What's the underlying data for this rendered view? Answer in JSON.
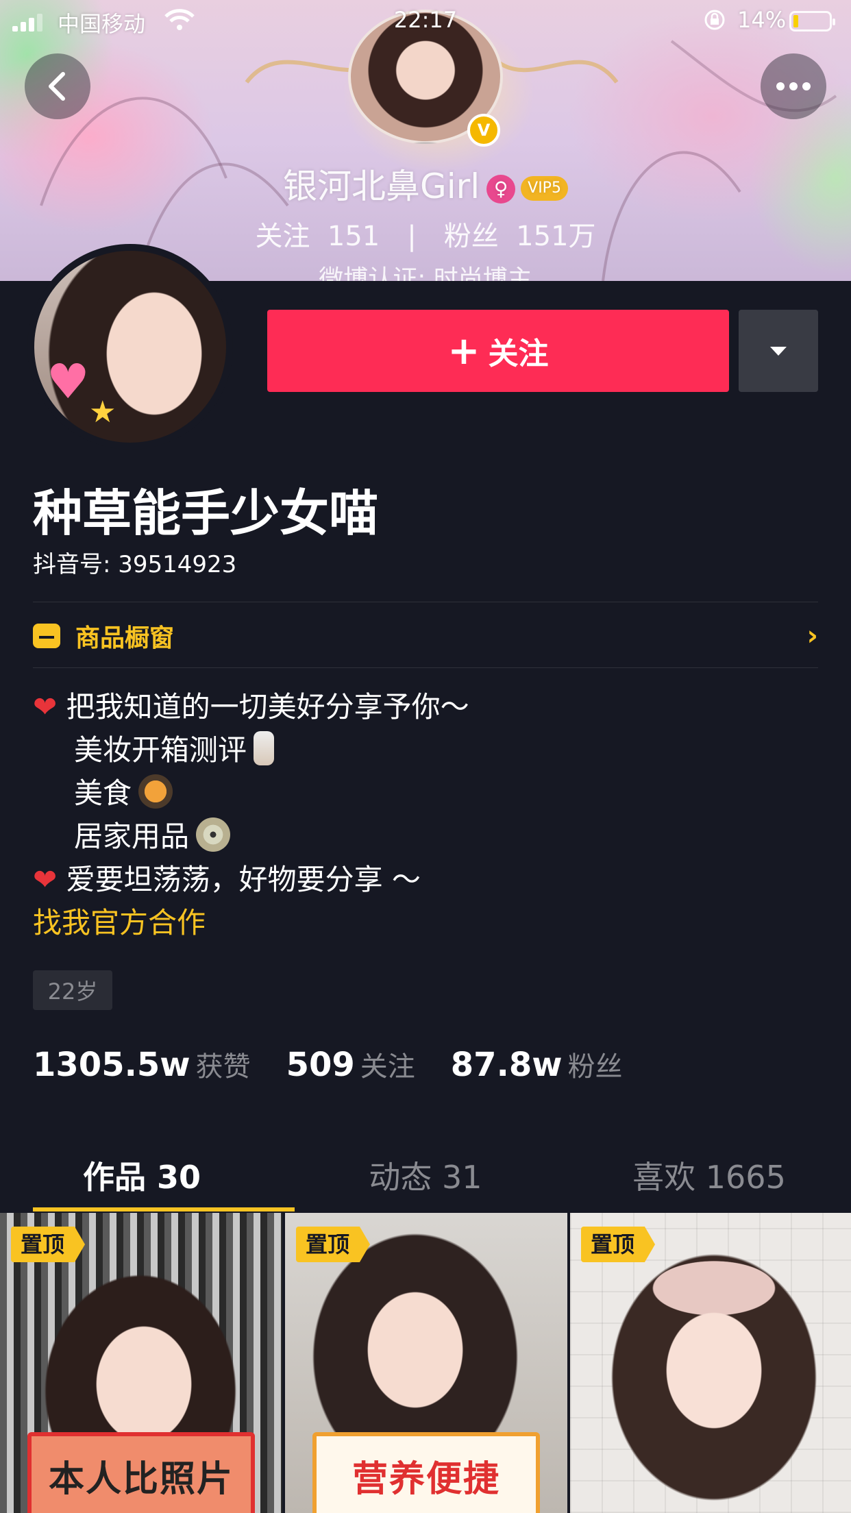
{
  "status_bar": {
    "carrier": "中国移动",
    "time": "22:17",
    "battery_pct": "14%",
    "battery_level": 0.14
  },
  "banner": {
    "name": "银河北鼻Girl",
    "vip_label": "VIP5",
    "verified_badge": "V",
    "follow_label": "关注",
    "follow_count": "151",
    "fans_label": "粉丝",
    "fans_count": "151万",
    "verify_text": "微博认证: 时尚博主"
  },
  "profile": {
    "follow_button": "关注",
    "nickname": "种草能手少女喵",
    "douyin_id": "抖音号: 39514923",
    "shop_label": "商品橱窗",
    "bio": {
      "line1": "把我知道的一切美好分享予你～",
      "line2": "美妆开箱测评",
      "line3": "美食",
      "line4": "居家用品",
      "line5": "爱要坦荡荡，好物要分享 ～",
      "coop_link": "找我官方合作"
    },
    "age": "22岁"
  },
  "stats": [
    {
      "num": "1305.5w",
      "label": "获赞"
    },
    {
      "num": "509",
      "label": "关注"
    },
    {
      "num": "87.8w",
      "label": "粉丝"
    }
  ],
  "tabs": [
    {
      "label": "作品 30",
      "active": true
    },
    {
      "label": "动态 31",
      "active": false
    },
    {
      "label": "喜欢 1665",
      "active": false
    }
  ],
  "videos": [
    {
      "pin": "置顶",
      "caption": "本人比照片"
    },
    {
      "pin": "置顶",
      "caption": "营养便捷"
    },
    {
      "pin": "置顶",
      "caption": ""
    }
  ],
  "colors": {
    "background": "#161823",
    "accent_red": "#fe2c55",
    "accent_yellow": "#f9c322",
    "muted_text": "#8a8b91"
  },
  "icons": [
    "signal-icon",
    "wifi-icon",
    "orientation-lock-icon",
    "battery-icon",
    "back-icon",
    "more-icon",
    "verified-icon",
    "female-icon",
    "dropdown-icon",
    "shop-icon",
    "chevron-right-icon",
    "heart-icon"
  ]
}
